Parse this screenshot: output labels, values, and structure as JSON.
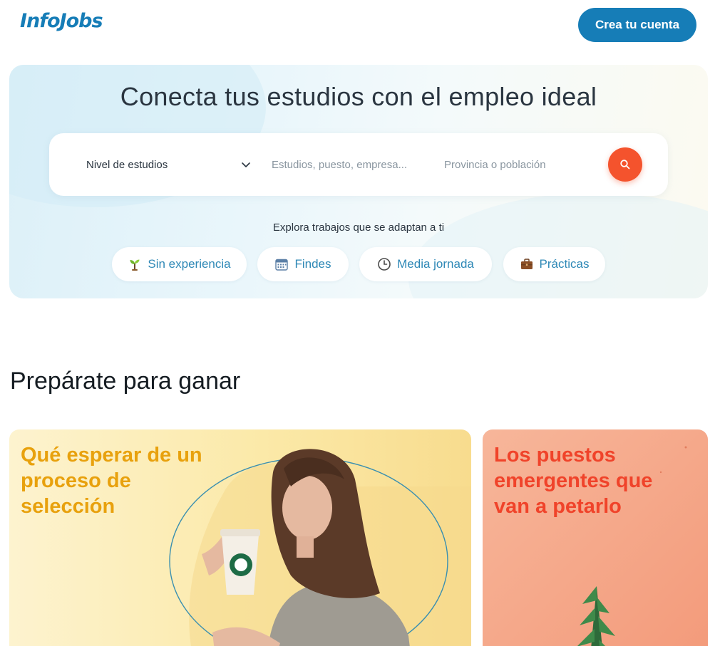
{
  "header": {
    "logo": "InfoJobs",
    "cta_label": "Crea tu cuenta"
  },
  "hero": {
    "title": "Conecta tus estudios con el empleo ideal",
    "search": {
      "level_select": "Nivel de estudios",
      "studies_placeholder": "Estudios, puesto, empresa...",
      "place_placeholder": "Provincia o población"
    },
    "explore_label": "Explora trabajos que se adaptan a ti",
    "chips": [
      {
        "label": "Sin experiencia",
        "icon": "seedling-icon"
      },
      {
        "label": "Findes",
        "icon": "calendar-icon"
      },
      {
        "label": "Media jornada",
        "icon": "clock-icon"
      },
      {
        "label": "Prácticas",
        "icon": "briefcase-icon"
      }
    ]
  },
  "section": {
    "title": "Prepárate para ganar",
    "cards": [
      {
        "title": "Qué esperar de un proceso de selección"
      },
      {
        "title": "Los puestos emergentes que van a petarlo"
      }
    ]
  },
  "colors": {
    "brand_blue": "#167db7",
    "search_orange": "#f4532d",
    "card1_title": "#e8a10d",
    "card2_title": "#f0432a"
  }
}
